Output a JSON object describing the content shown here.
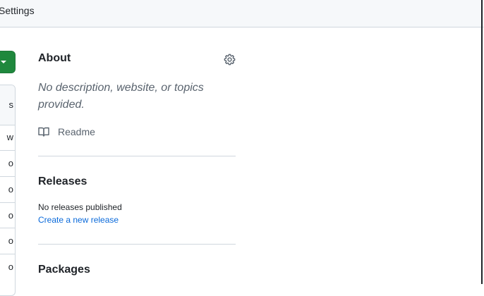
{
  "topbar": {
    "settings_label": "Settings"
  },
  "left_column": {
    "table_header_fragment": "s",
    "row_fragments": [
      "w",
      "o",
      "o",
      "o",
      "o",
      "o"
    ]
  },
  "about": {
    "title": "About",
    "settings_icon": "gear-icon",
    "description": "No description, website, or topics provided.",
    "readme_icon": "book-icon",
    "readme_label": "Readme"
  },
  "releases": {
    "title": "Releases",
    "empty_text": "No releases published",
    "create_link": "Create a new release"
  },
  "packages": {
    "title": "Packages"
  },
  "colors": {
    "primary_button": "#1f883d",
    "link": "#0969da",
    "muted_text": "#59636e",
    "border": "#d0d7de"
  }
}
